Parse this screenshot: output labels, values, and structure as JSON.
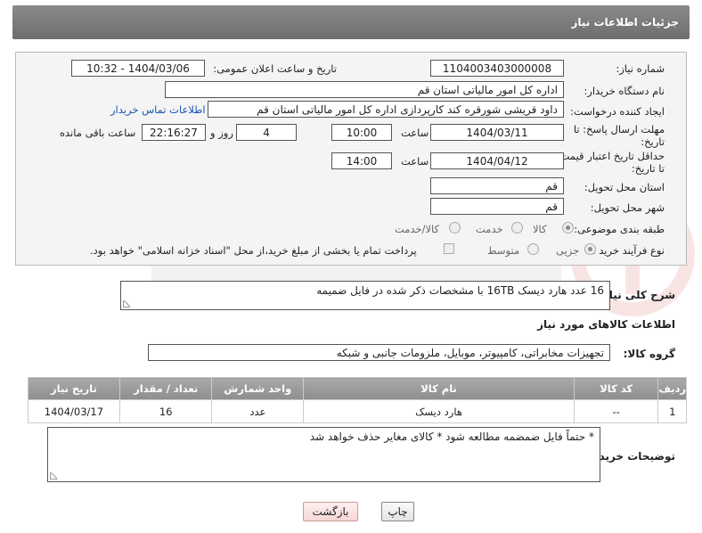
{
  "header": {
    "title": "جزئیات اطلاعات نیاز"
  },
  "form": {
    "need_number": {
      "label": "شماره نیاز:",
      "value": "1104003403000008"
    },
    "announce": {
      "label": "تاریخ و ساعت اعلان عمومی:",
      "value": "1404/03/06 - 10:32"
    },
    "buyer_org": {
      "label": "نام دستگاه خریدار:",
      "value": "اداره کل امور مالیاتی استان قم"
    },
    "creator": {
      "label": "ایجاد کننده درخواست:",
      "value": "داود قریشی شورقره کند کارپردازی اداره کل امور مالیاتی استان قم",
      "link": "اطلاعات تماس خریدار"
    },
    "reply_deadline": {
      "label": "مهلت ارسال پاسخ: تا تاریخ:",
      "date": "1404/03/11",
      "time_label": "ساعت",
      "time": "10:00",
      "days": "4",
      "days_label": "روز و",
      "remaining": "22:16:27",
      "remaining_label": "ساعت باقی مانده"
    },
    "price_validity": {
      "label": "حداقل تاریخ اعتبار قیمت: تا تاریخ:",
      "date": "1404/04/12",
      "time_label": "ساعت",
      "time": "14:00"
    },
    "province": {
      "label": "استان محل تحویل:",
      "value": "قم"
    },
    "city": {
      "label": "شهر محل تحویل:",
      "value": "قم"
    },
    "category": {
      "label": "طبقه بندی موضوعی:",
      "options": [
        "کالا",
        "خدمت",
        "کالا/خدمت"
      ]
    },
    "process": {
      "label": "نوع فرآیند خرید :",
      "options": [
        "جزیی",
        "متوسط"
      ],
      "payment_note": "پرداخت تمام یا بخشی از مبلغ خرید،از محل \"اسناد خزانه اسلامی\" خواهد بود."
    }
  },
  "description": {
    "label": "شرح کلی نیاز:",
    "value": "16 عدد هارد دیسک 16TB با مشخصات ذکر شده در فایل ضمیمه"
  },
  "goods_section": {
    "title": "اطلاعات کالاهای مورد نیاز",
    "group_label": "گروه کالا:",
    "group_value": "تجهیزات مخابراتی، کامپیوتر، موبایل، ملزومات جانبی و شبکه"
  },
  "table": {
    "headers": [
      "ردیف",
      "کد کالا",
      "نام کالا",
      "واحد شمارش",
      "تعداد / مقدار",
      "تاریخ نیاز"
    ],
    "rows": [
      [
        "1",
        "--",
        "هارد دیسک",
        "عدد",
        "16",
        "1404/03/17"
      ]
    ]
  },
  "buyer_notes": {
    "label": "توضیحات خریدار:",
    "value": "* حتماً فایل ضمضمه مطالعه شود * کالای مغایر حذف خواهد شد"
  },
  "buttons": {
    "print": "چاپ",
    "back": "بازگشت"
  }
}
